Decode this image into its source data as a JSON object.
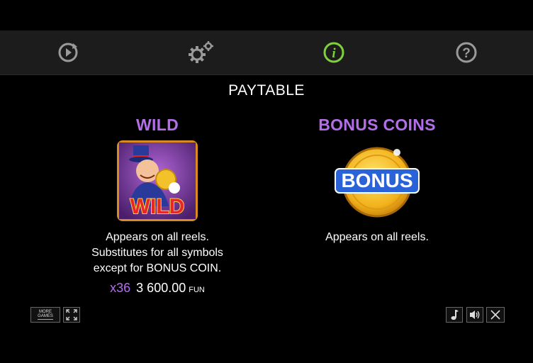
{
  "toolbar": {
    "items": [
      {
        "icon": "replay-icon",
        "active": false
      },
      {
        "icon": "settings-icon",
        "active": false
      },
      {
        "icon": "info-icon",
        "active": true
      },
      {
        "icon": "help-icon",
        "active": false
      }
    ],
    "active_color": "#7fd13b",
    "inactive_color": "#9a9a9a"
  },
  "page": {
    "title": "PAYTABLE"
  },
  "symbols": {
    "wild": {
      "name": "WILD",
      "image_text": "WILD",
      "description_lines": [
        "Appears on all reels.",
        "Substitutes for all symbols",
        "except for BONUS COIN."
      ],
      "multiplier": "x36",
      "amount": "3 600.00",
      "currency": "FUN"
    },
    "bonus": {
      "name": "BONUS COINS",
      "image_text": "BONUS",
      "description_lines": [
        "Appears on all reels."
      ]
    }
  },
  "bottom": {
    "more_games_label_1": "MORE",
    "more_games_label_2": "GAMES"
  },
  "colors": {
    "accent": "#b36ee8",
    "background": "#000000",
    "toolbar_bg": "#1c1c1c"
  }
}
